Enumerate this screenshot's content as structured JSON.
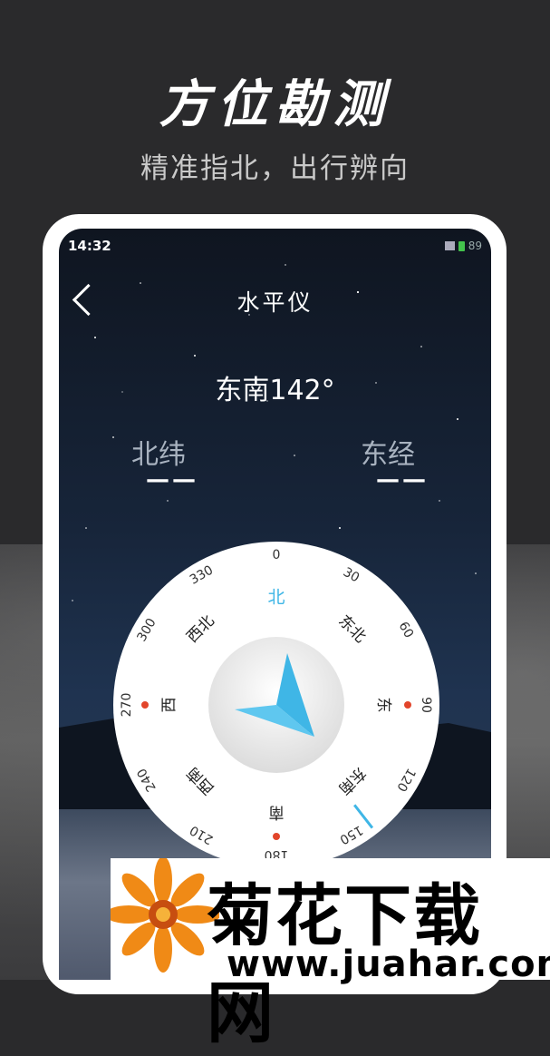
{
  "promo": {
    "headline": "方位勘测",
    "subhead": "精准指北，出行辨向"
  },
  "status_bar": {
    "time": "14:32",
    "battery": "89"
  },
  "app": {
    "title": "水平仪",
    "heading": "东南142°",
    "latitude_label": "北纬",
    "latitude_value": "——",
    "longitude_label": "东经",
    "longitude_value": "——"
  },
  "compass": {
    "degree_marks": [
      "0",
      "30",
      "60",
      "90",
      "120",
      "150",
      "180",
      "210",
      "240",
      "270",
      "300",
      "330"
    ],
    "direction_labels": [
      "北",
      "东北",
      "东",
      "东南",
      "南",
      "西南",
      "西",
      "西北"
    ],
    "heading_degrees": 142,
    "accent": "#3fb6e6",
    "marker_color": "#e2452b"
  },
  "watermark": {
    "name": "菊花下载网",
    "url": "www.juahar.com"
  }
}
